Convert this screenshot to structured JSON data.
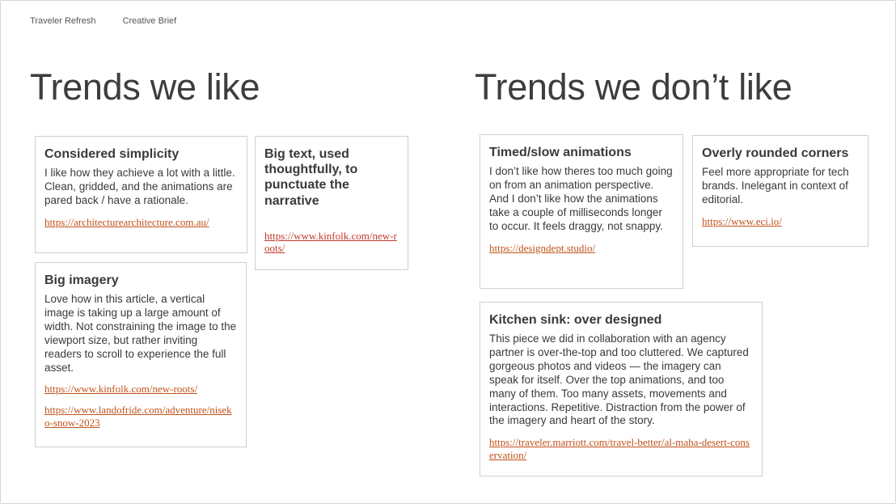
{
  "nav": {
    "item1": "Traveler Refresh",
    "item2": "Creative Brief"
  },
  "left": {
    "title": "Trends we like",
    "cards": [
      {
        "title": "Considered simplicity",
        "body": "I like how they achieve a lot with a little. Clean, gridded, and the animations are pared back / have a rationale.",
        "links": [
          "https://architecturearchitecture.com.au/"
        ]
      },
      {
        "title": "Big text, used thoughtfully, to punctuate the narrative",
        "body": "",
        "links": [
          "https://www.kinfolk.com/new-roots/"
        ]
      },
      {
        "title": "Big imagery",
        "body": "Love how in this article, a vertical image is taking up a large amount of width. Not constraining the image to the viewport size, but rather inviting readers to scroll to experience the full asset.",
        "links": [
          "https://www.kinfolk.com/new-roots/",
          "https://www.landofride.com/adventure/niseko-snow-2023"
        ]
      }
    ]
  },
  "right": {
    "title": "Trends we don’t like",
    "cards": [
      {
        "title": "Timed/slow animations",
        "body": "I don’t like how theres too much going on from an animation perspective. And I don’t like how the animations take a couple of milliseconds longer to occur. It feels draggy, not snappy.",
        "links": [
          "https://designdept.studio/"
        ]
      },
      {
        "title": "Overly rounded corners",
        "body": "Feel more appropriate for tech brands. Inelegant in context of editorial.",
        "links": [
          "https://www.eci.io/"
        ]
      },
      {
        "title": "Kitchen sink: over designed",
        "body": "This piece we did in collaboration with an agency partner is over-the-top and too cluttered. We captured gorgeous photos and videos — the imagery can speak for itself. Over the top animations, and too many of them. Too many assets, movements and interactions. Repetitive. Distraction from the power of the imagery and heart of the story.",
        "links": [
          "https://traveler.marriott.com/travel-better/al-maha-desert-conservation/"
        ]
      }
    ]
  },
  "colors": {
    "link": "#c0521a",
    "text": "#3a3a3a",
    "border": "#cfcfcf"
  }
}
